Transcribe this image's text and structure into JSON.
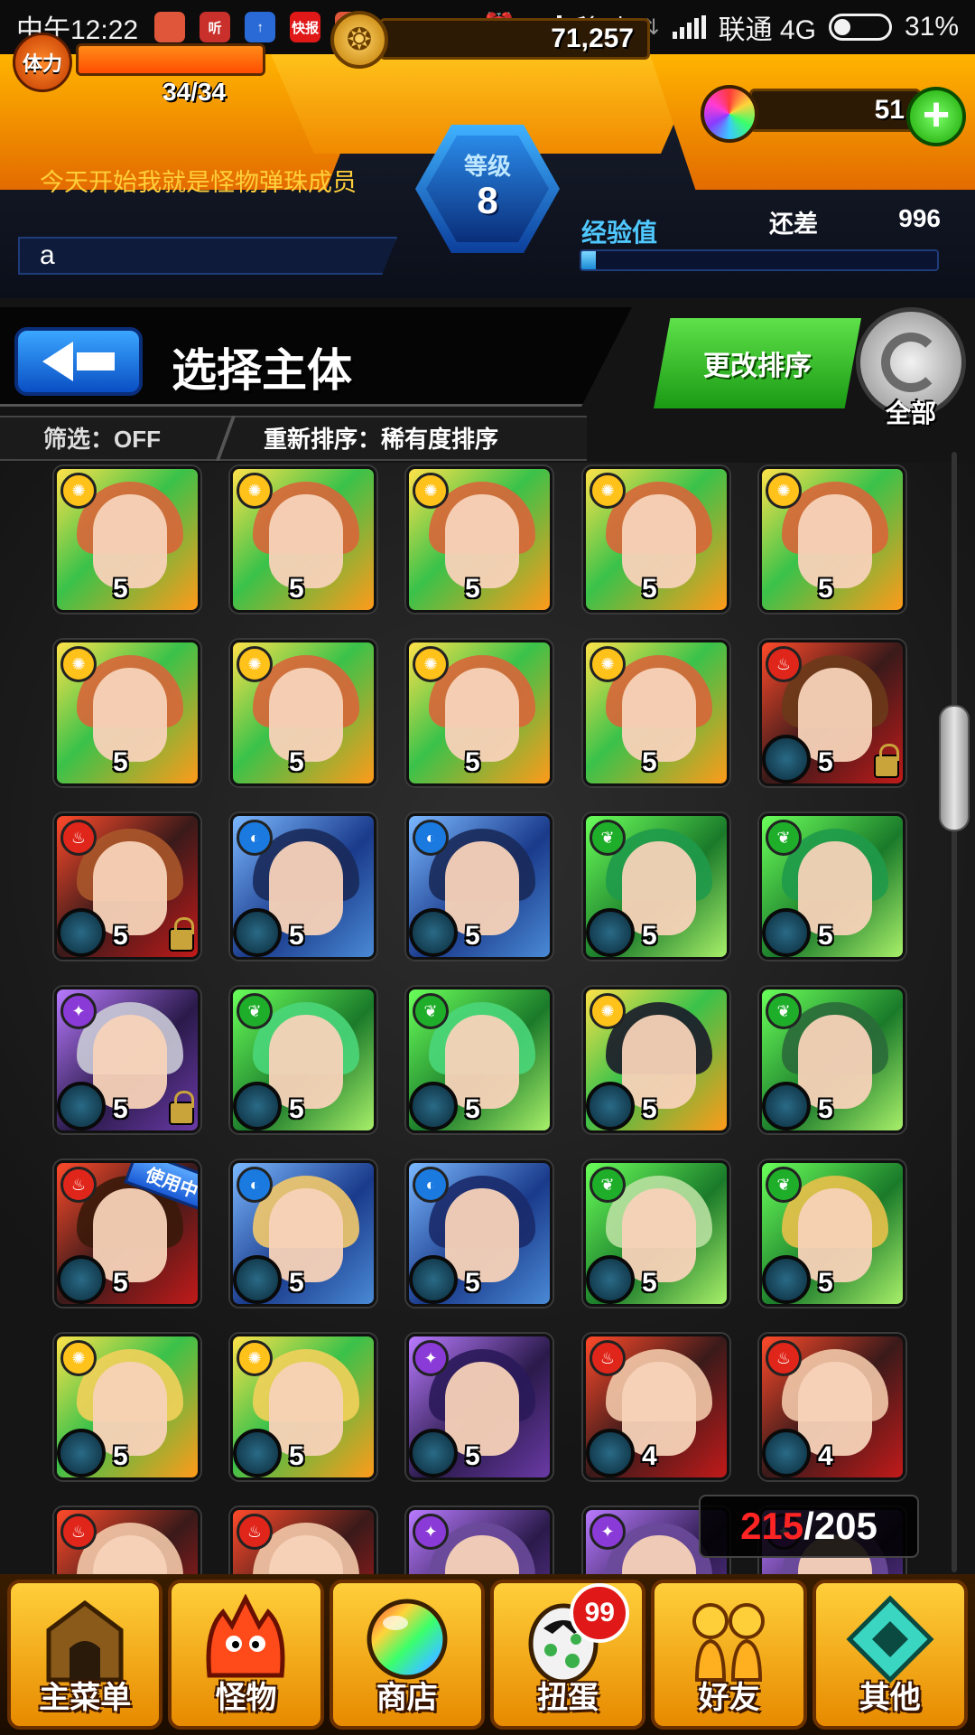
{
  "status_bar": {
    "time": "中午12:22",
    "apps": [
      {
        "icon": "weibo-icon",
        "text": "",
        "color": "#e0563a"
      },
      {
        "icon": "ting-icon",
        "text": "听",
        "color": "#c9302c"
      },
      {
        "icon": "upload-icon",
        "text": "↑",
        "color": "#2a6ad6"
      },
      {
        "icon": "news-icon",
        "text": "快报",
        "color": "#e01818"
      },
      {
        "icon": "weibo-icon",
        "text": "",
        "color": "#e0563a"
      }
    ],
    "more": "•••",
    "carrier1": "移动",
    "carrier2": "联通 4G",
    "battery": "31%",
    "battery_level": 0.31
  },
  "hud": {
    "stamina_label": "体力",
    "stamina_text": "34/34",
    "stamina_fraction": 1.0,
    "gold": "71,257",
    "orbs": "51",
    "plus": "+",
    "level_label": "等级",
    "level_value": "8",
    "motto": "今天开始我就是怪物弹珠成员",
    "player_name": "a",
    "exp_label": "经验值",
    "exp_remain_label": "还差",
    "exp_remain_value": "996",
    "exp_fraction": 0.04
  },
  "header": {
    "title": "选择主体",
    "sort_button": "更改排序",
    "refresh_label": "全部",
    "filter": "筛选：OFF",
    "resort": "重新排序：稀有度排序"
  },
  "grid": {
    "monsters": [
      {
        "attr": "light",
        "star": "5",
        "lock": false,
        "theme": "yellow",
        "hair": "#d8663a",
        "orb": false
      },
      {
        "attr": "light",
        "star": "5",
        "lock": false,
        "theme": "yellow",
        "hair": "#d8663a",
        "orb": false
      },
      {
        "attr": "light",
        "star": "5",
        "lock": false,
        "theme": "yellow",
        "hair": "#d8663a",
        "orb": false
      },
      {
        "attr": "light",
        "star": "5",
        "lock": false,
        "theme": "yellow",
        "hair": "#d8663a",
        "orb": false
      },
      {
        "attr": "light",
        "star": "5",
        "lock": false,
        "theme": "yellow",
        "hair": "#d8663a",
        "orb": false
      },
      {
        "attr": "light",
        "star": "5",
        "lock": false,
        "theme": "yellow",
        "hair": "#d8663a",
        "orb": false
      },
      {
        "attr": "light",
        "star": "5",
        "lock": false,
        "theme": "yellow",
        "hair": "#d8663a",
        "orb": false
      },
      {
        "attr": "light",
        "star": "5",
        "lock": false,
        "theme": "yellow",
        "hair": "#d8663a",
        "orb": false
      },
      {
        "attr": "light",
        "star": "5",
        "lock": false,
        "theme": "yellow",
        "hair": "#d8663a",
        "orb": false
      },
      {
        "attr": "fire",
        "star": "5",
        "lock": true,
        "theme": "red",
        "hair": "#6a3a1a",
        "orb": true
      },
      {
        "attr": "fire",
        "star": "5",
        "lock": true,
        "theme": "red",
        "hair": "#a8562a",
        "orb": true
      },
      {
        "attr": "water",
        "star": "5",
        "lock": false,
        "theme": "blue",
        "hair": "#1a2a5a",
        "orb": true
      },
      {
        "attr": "water",
        "star": "5",
        "lock": false,
        "theme": "blue",
        "hair": "#1a2a5a",
        "orb": true
      },
      {
        "attr": "wood",
        "star": "5",
        "lock": false,
        "theme": "green",
        "hair": "#1f9a4a",
        "orb": true
      },
      {
        "attr": "wood",
        "star": "5",
        "lock": false,
        "theme": "green",
        "hair": "#1f9a4a",
        "orb": true
      },
      {
        "attr": "dark",
        "star": "5",
        "lock": true,
        "theme": "purple",
        "hair": "#c9c9d6",
        "orb": true
      },
      {
        "attr": "wood",
        "star": "5",
        "lock": false,
        "theme": "green",
        "hair": "#4ad67a",
        "orb": true
      },
      {
        "attr": "wood",
        "star": "5",
        "lock": false,
        "theme": "green",
        "hair": "#4ad67a",
        "orb": true
      },
      {
        "attr": "light",
        "star": "5",
        "lock": false,
        "theme": "yellow",
        "hair": "#1a1a2a",
        "orb": true
      },
      {
        "attr": "wood",
        "star": "5",
        "lock": false,
        "theme": "green",
        "hair": "#2a6a3a",
        "orb": true
      },
      {
        "attr": "fire",
        "star": "5",
        "lock": false,
        "theme": "red",
        "hair": "#3a1a0a",
        "orb": true,
        "in_use": true
      },
      {
        "attr": "water",
        "star": "5",
        "lock": false,
        "theme": "blue",
        "hair": "#f2c86a",
        "orb": true
      },
      {
        "attr": "water",
        "star": "5",
        "lock": false,
        "theme": "blue",
        "hair": "#1a2a6a",
        "orb": true
      },
      {
        "attr": "wood",
        "star": "5",
        "lock": false,
        "theme": "green",
        "hair": "#b8e0a0",
        "orb": true
      },
      {
        "attr": "wood",
        "star": "5",
        "lock": false,
        "theme": "green",
        "hair": "#e8c04a",
        "orb": true
      },
      {
        "attr": "light",
        "star": "5",
        "lock": false,
        "theme": "yellow",
        "hair": "#f2d05a",
        "orb": true
      },
      {
        "attr": "light",
        "star": "5",
        "lock": false,
        "theme": "yellow",
        "hair": "#f2d05a",
        "orb": true
      },
      {
        "attr": "dark",
        "star": "5",
        "lock": false,
        "theme": "purple",
        "hair": "#2a1a5a",
        "orb": true
      },
      {
        "attr": "fire",
        "star": "4",
        "lock": false,
        "theme": "red",
        "hair": "#f2c8a8",
        "orb": true
      },
      {
        "attr": "fire",
        "star": "4",
        "lock": false,
        "theme": "red",
        "hair": "#f2c8a8",
        "orb": true
      },
      {
        "attr": "fire",
        "star": "",
        "lock": false,
        "theme": "red",
        "hair": "#f2c8a8",
        "orb": false
      },
      {
        "attr": "fire",
        "star": "",
        "lock": false,
        "theme": "red",
        "hair": "#f2c8a8",
        "orb": false
      },
      {
        "attr": "dark",
        "star": "",
        "lock": false,
        "theme": "purple",
        "hair": "#6a4a9a",
        "orb": false
      },
      {
        "attr": "dark",
        "star": "",
        "lock": false,
        "theme": "purple",
        "hair": "#6a4a9a",
        "orb": false
      },
      {
        "attr": "dark",
        "star": "",
        "lock": false,
        "theme": "purple",
        "hair": "#6a4a9a",
        "orb": false
      }
    ],
    "in_use_label": "使用中"
  },
  "box_count": {
    "current": "215",
    "max": "/205"
  },
  "bottom_nav": [
    {
      "label": "主菜单",
      "icon": "castle-icon"
    },
    {
      "label": "怪物",
      "icon": "monster-icon"
    },
    {
      "label": "商店",
      "icon": "rainbow-orb-icon"
    },
    {
      "label": "扭蛋",
      "icon": "egg-icon",
      "badge": "99"
    },
    {
      "label": "好友",
      "icon": "friends-icon"
    },
    {
      "label": "其他",
      "icon": "other-icon"
    }
  ],
  "colors": {
    "light": "#ffc21a",
    "fire": "#e0261a",
    "water": "#1a7ae0",
    "wood": "#1fae2a",
    "dark": "#8a3ad6"
  }
}
